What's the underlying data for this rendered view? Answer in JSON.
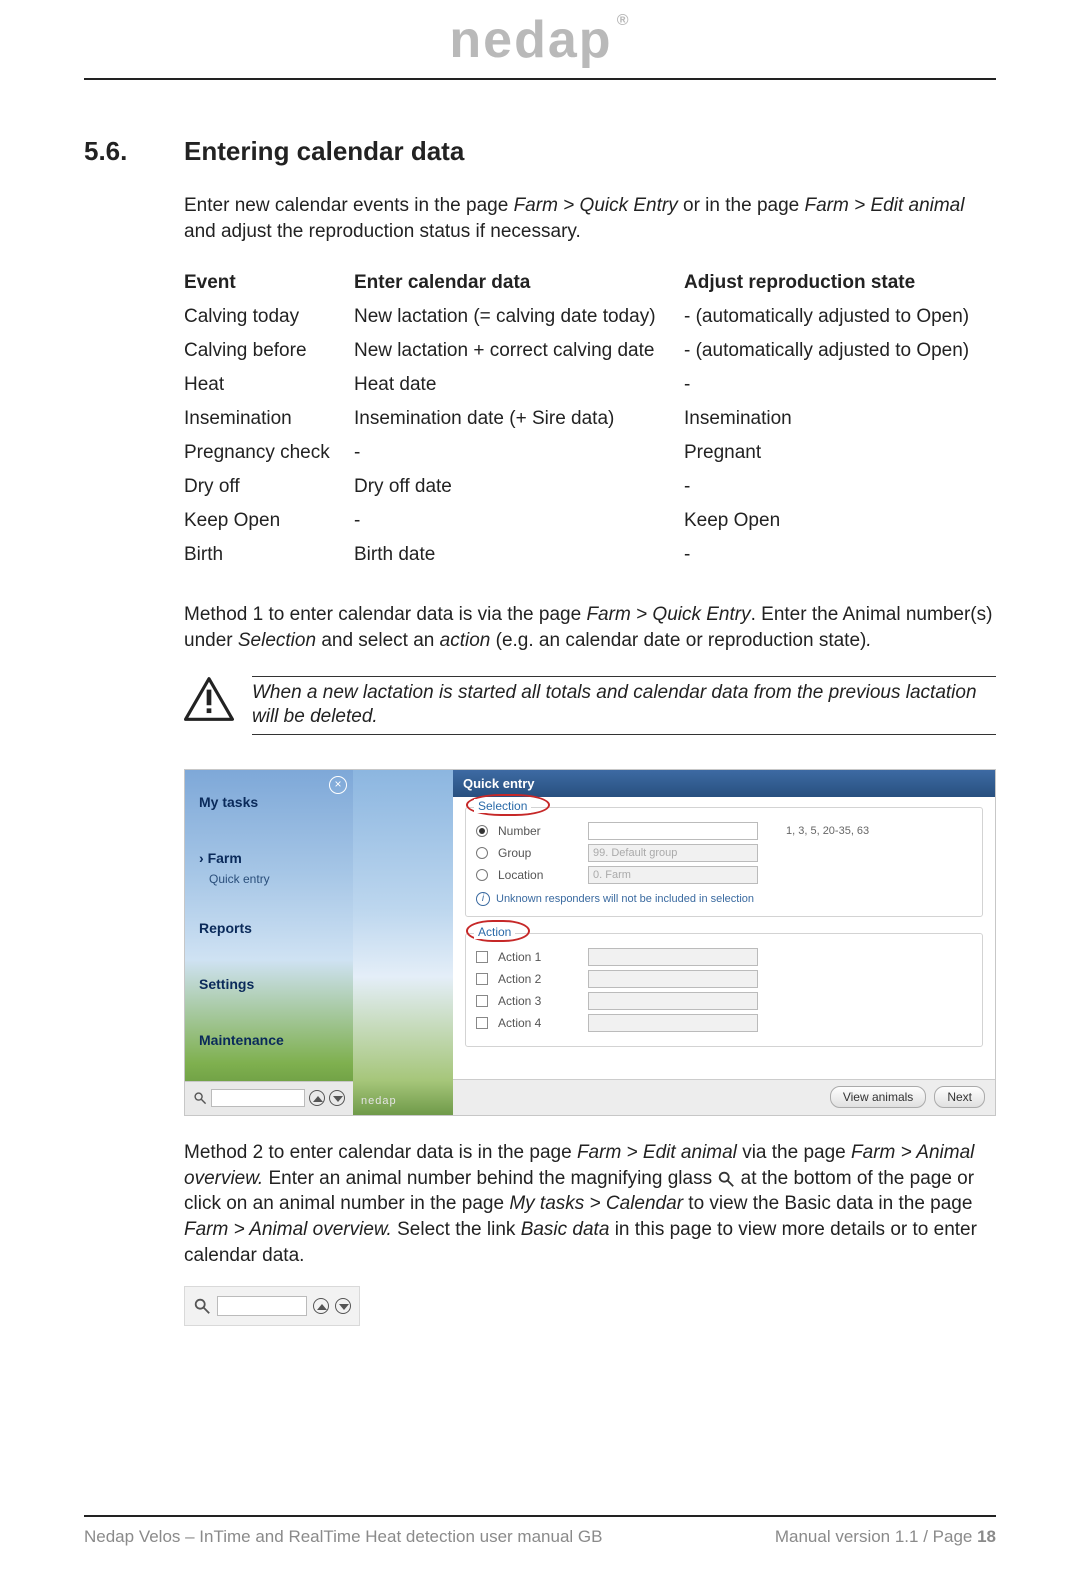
{
  "brand": "nedap",
  "section_number": "5.6.",
  "section_title": "Entering calendar data",
  "intro": {
    "p1a": "Enter new calendar events in the page ",
    "p1_i1": "Farm > Quick Entry",
    "p1b": " or in the page ",
    "p1_i2": "Farm > Edit animal",
    "p1c": " and adjust the reproduction status if necessary."
  },
  "table": {
    "h1": "Event",
    "h2": "Enter calendar data",
    "h3": "Adjust reproduction state",
    "rows": [
      {
        "c1": "Calving today",
        "c2": "New lactation (= calving date today)",
        "c3": "- (automatically adjusted to Open)"
      },
      {
        "c1": "Calving before",
        "c2": "New lactation + correct calving date",
        "c3": "- (automatically adjusted to Open)"
      },
      {
        "c1": "Heat",
        "c2": "Heat date",
        "c3": "-"
      },
      {
        "c1": "Insemination",
        "c2": "Insemination date (+ Sire data)",
        "c3": "Insemination"
      },
      {
        "c1": "Pregnancy check",
        "c2": "-",
        "c3": "Pregnant"
      },
      {
        "c1": "Dry off",
        "c2": "Dry off date",
        "c3": "-"
      },
      {
        "c1": "Keep Open",
        "c2": "-",
        "c3": "Keep Open"
      },
      {
        "c1": "Birth",
        "c2": "Birth date",
        "c3": "-"
      }
    ]
  },
  "method1": {
    "a": "Method 1 to enter calendar data is via the page ",
    "i1": "Farm > Quick Entry",
    "b": ". Enter the Animal number(s) under ",
    "i2": "Selection",
    "c": " and select an ",
    "i3": "action",
    "d": " (e.g. an calendar date or reproduction state)",
    "e": "."
  },
  "warning": "When a new lactation is started all totals and calendar data from the previous lactation will be deleted.",
  "screenshot": {
    "nav": {
      "my_tasks": "My tasks",
      "farm": "Farm",
      "quick_entry": "Quick entry",
      "reports": "Reports",
      "settings": "Settings",
      "maintenance": "Maintenance"
    },
    "mid_brand": "nedap",
    "panel_title": "Quick entry",
    "selection": {
      "legend": "Selection",
      "number": "Number",
      "group": "Group",
      "location": "Location",
      "group_placeholder": "99. Default group",
      "location_placeholder": "0. Farm",
      "hint": "1, 3, 5, 20-35, 63",
      "info": "Unknown responders will not be included in selection"
    },
    "action": {
      "legend": "Action",
      "a1": "Action 1",
      "a2": "Action 2",
      "a3": "Action 3",
      "a4": "Action 4"
    },
    "buttons": {
      "view": "View animals",
      "next": "Next"
    }
  },
  "method2": {
    "a": "Method 2 to enter calendar data is in the page ",
    "i1": "Farm > Edit animal",
    "b": " via the page ",
    "i2": "Farm > Animal overview.",
    "c": " Enter an animal number behind the magnifying glass ",
    "d": " at the bottom of the page or click on an animal number in the page ",
    "i3": "My tasks > Calendar",
    "e": " to view the Basic data in the page ",
    "i4": "Farm > Animal overview.",
    "f": " Select the link ",
    "i5": "Basic data",
    "g": " in this page to view more details or to enter calendar data."
  },
  "footer": {
    "left": "Nedap Velos – InTime and RealTime Heat detection user manual GB",
    "right_a": "Manual version 1.1 / Page ",
    "right_b": "18"
  }
}
